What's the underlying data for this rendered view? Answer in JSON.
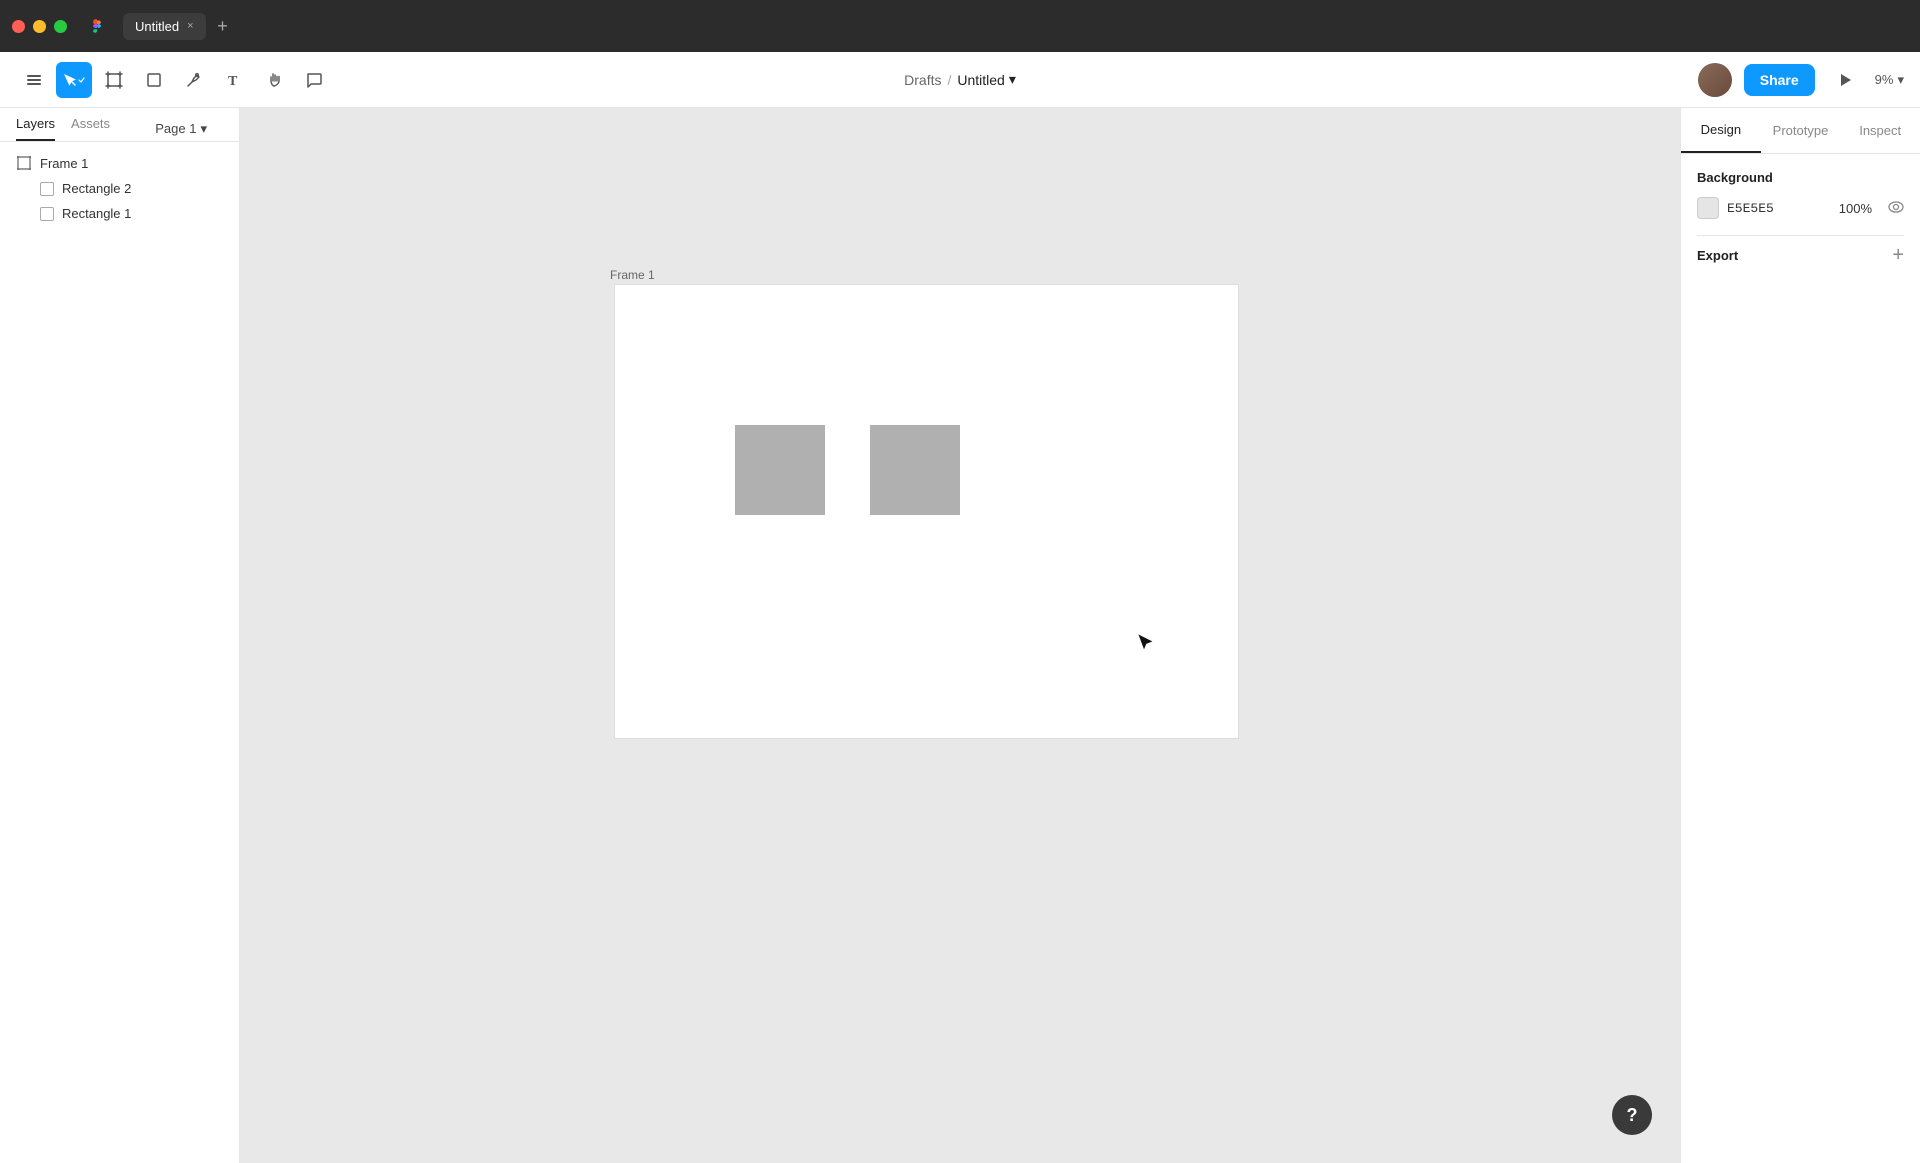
{
  "titlebar": {
    "tab_name": "Untitled",
    "tab_close": "×",
    "tab_add": "+"
  },
  "toolbar": {
    "breadcrumb_drafts": "Drafts",
    "breadcrumb_separator": "/",
    "file_name": "Untitled",
    "chevron_down": "▾",
    "share_label": "Share",
    "zoom_level": "9%",
    "zoom_chevron": "▾"
  },
  "left_panel": {
    "tab_layers": "Layers",
    "tab_assets": "Assets",
    "page_selector": "Page 1",
    "page_chevron": "▾",
    "layers": [
      {
        "name": "Frame 1",
        "type": "frame",
        "indent": 0
      },
      {
        "name": "Rectangle 2",
        "type": "rect",
        "indent": 1
      },
      {
        "name": "Rectangle 1",
        "type": "rect",
        "indent": 1
      }
    ]
  },
  "canvas": {
    "frame_label": "Frame 1",
    "background_color": "#e8e8e8"
  },
  "right_panel": {
    "tab_design": "Design",
    "tab_prototype": "Prototype",
    "tab_inspect": "Inspect",
    "section_background": "Background",
    "bg_color_hex": "E5E5E5",
    "bg_opacity": "100%",
    "section_export": "Export",
    "export_add": "+"
  },
  "help_button": "?"
}
